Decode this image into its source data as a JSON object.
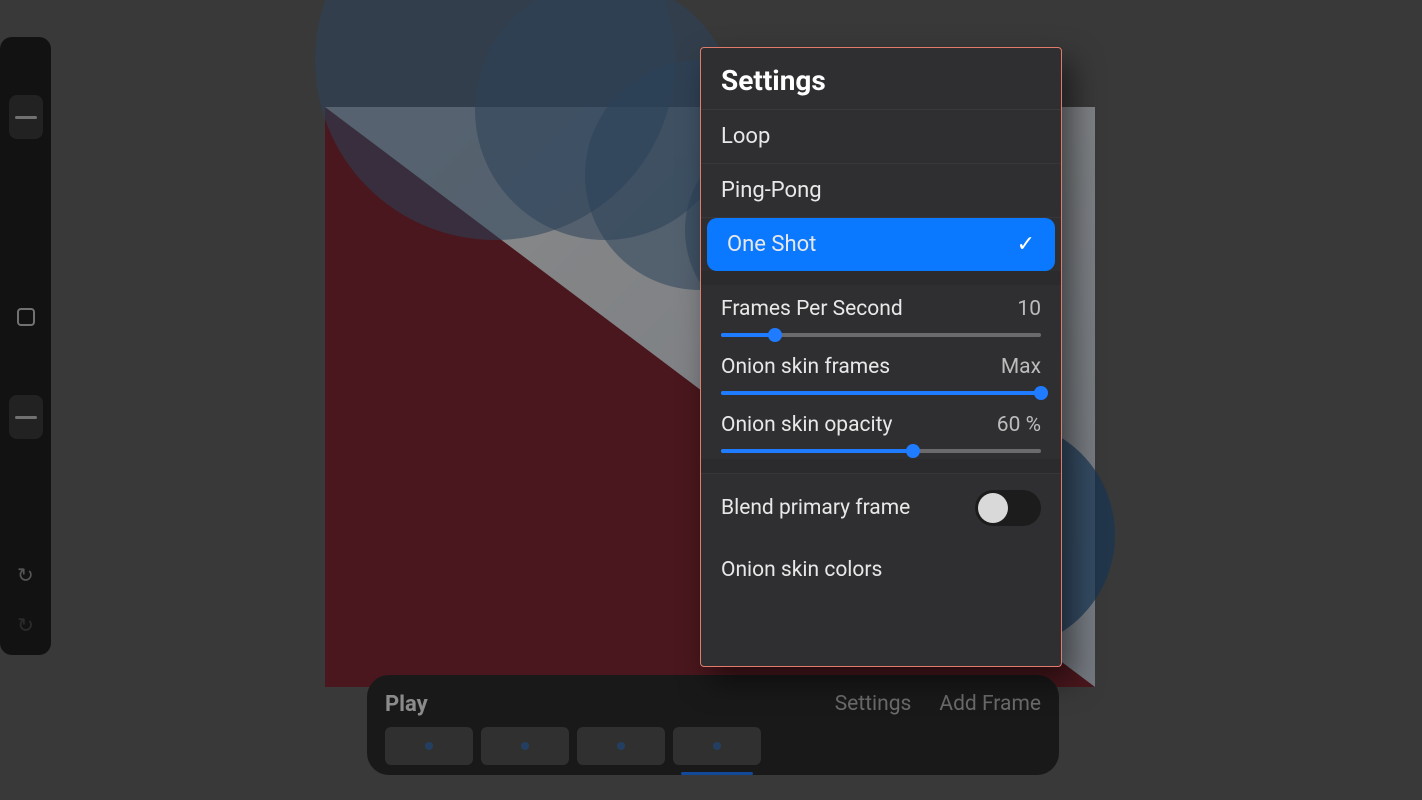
{
  "sidebar": {
    "tools": [
      {
        "id": "tool-1",
        "active": false
      },
      {
        "id": "tool-2",
        "active": true
      },
      {
        "id": "tool-3",
        "active": false
      },
      {
        "id": "tool-4",
        "active": false
      },
      {
        "id": "tool-5",
        "active": false
      },
      {
        "id": "tool-shape",
        "active": false,
        "icon": "square"
      },
      {
        "id": "tool-6",
        "active": false
      },
      {
        "id": "tool-line",
        "active": true,
        "icon": "line"
      }
    ]
  },
  "timeline": {
    "play_label": "Play",
    "settings_label": "Settings",
    "add_frame_label": "Add Frame",
    "frames": [
      {
        "id": 1
      },
      {
        "id": 2
      },
      {
        "id": 3
      },
      {
        "id": 4,
        "active": true
      }
    ]
  },
  "settings": {
    "title": "Settings",
    "options": [
      {
        "label": "Loop",
        "selected": false
      },
      {
        "label": "Ping-Pong",
        "selected": false
      },
      {
        "label": "One Shot",
        "selected": true
      }
    ],
    "fps": {
      "label": "Frames Per Second",
      "value": "10",
      "percent": 17
    },
    "onion_frames": {
      "label": "Onion skin frames",
      "value": "Max",
      "percent": 100
    },
    "onion_opacity": {
      "label": "Onion skin opacity",
      "value": "60 %",
      "percent": 60
    },
    "blend": {
      "label": "Blend primary frame",
      "on": false
    },
    "onion_colors": {
      "label": "Onion skin colors"
    }
  }
}
